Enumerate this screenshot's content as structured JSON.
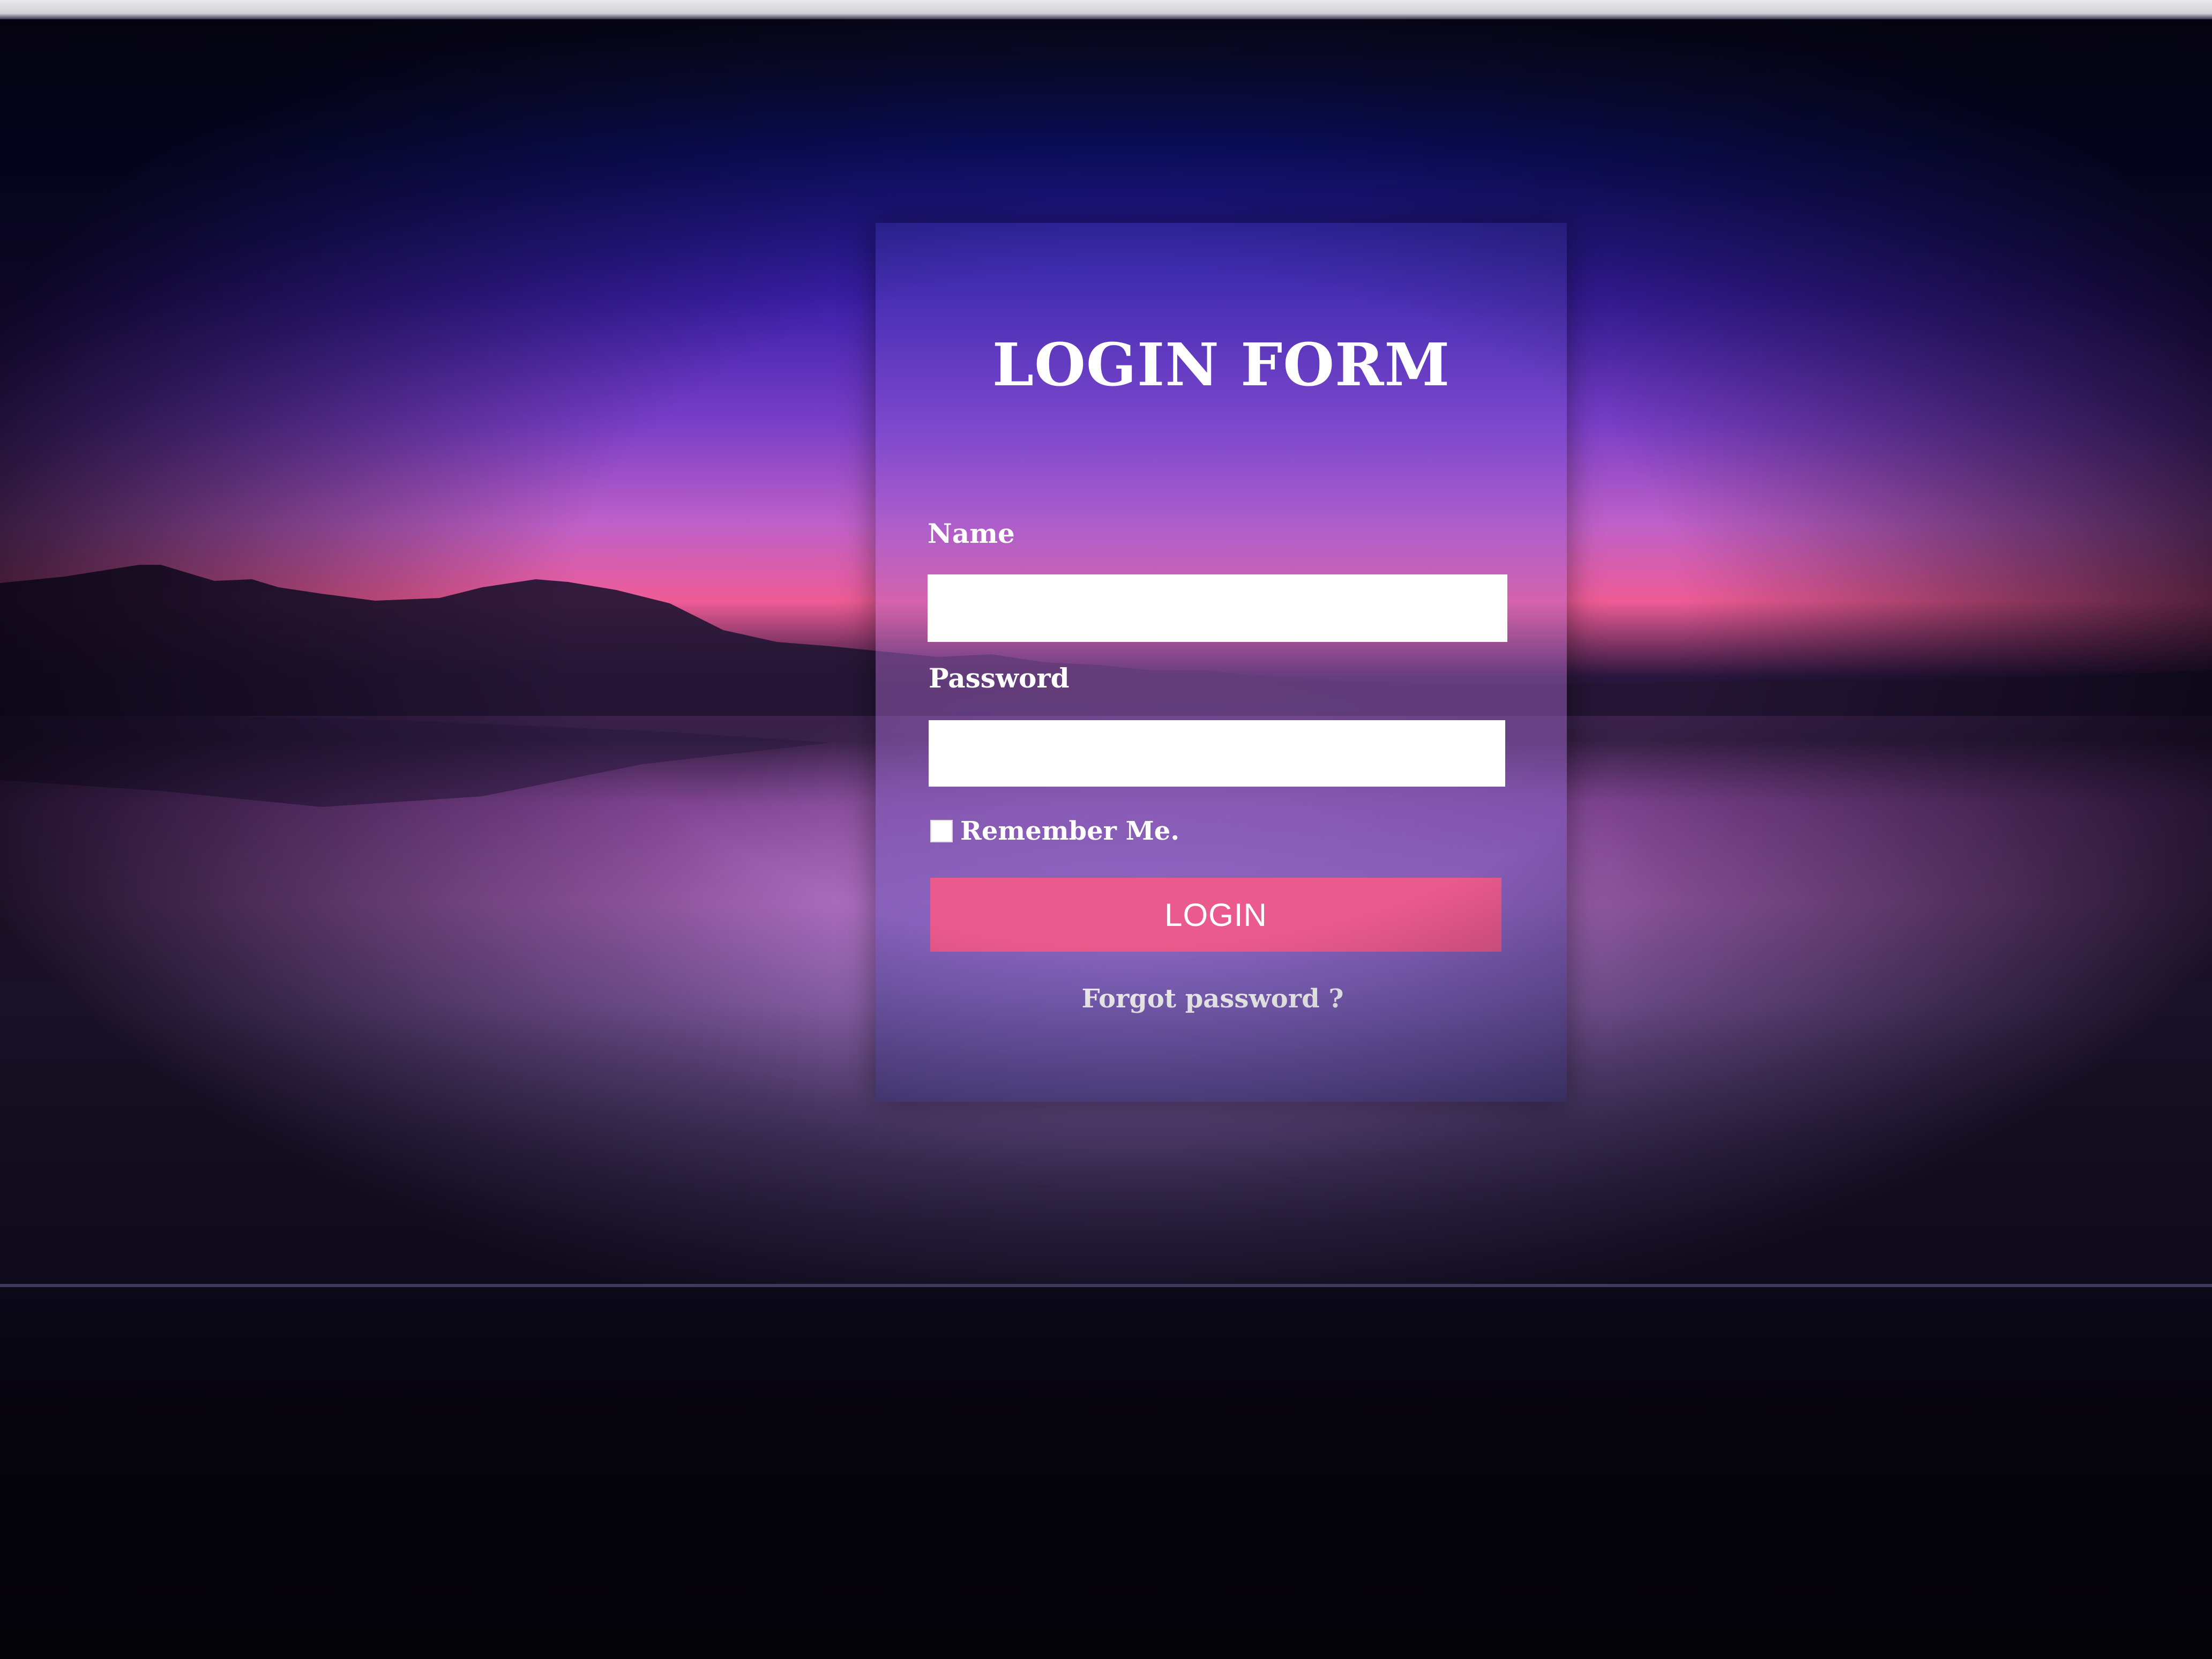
{
  "form": {
    "title": "LOGIN FORM",
    "name_label": "Name",
    "name_value": "",
    "password_label": "Password",
    "password_value": "",
    "remember_label": "Remember Me.",
    "remember_checked": false,
    "login_button": "LOGIN",
    "forgot_link": "Forgot password ?"
  },
  "colors": {
    "button": "#ea5a8c",
    "text": "#ffffff",
    "input_background": "#ffffff"
  }
}
